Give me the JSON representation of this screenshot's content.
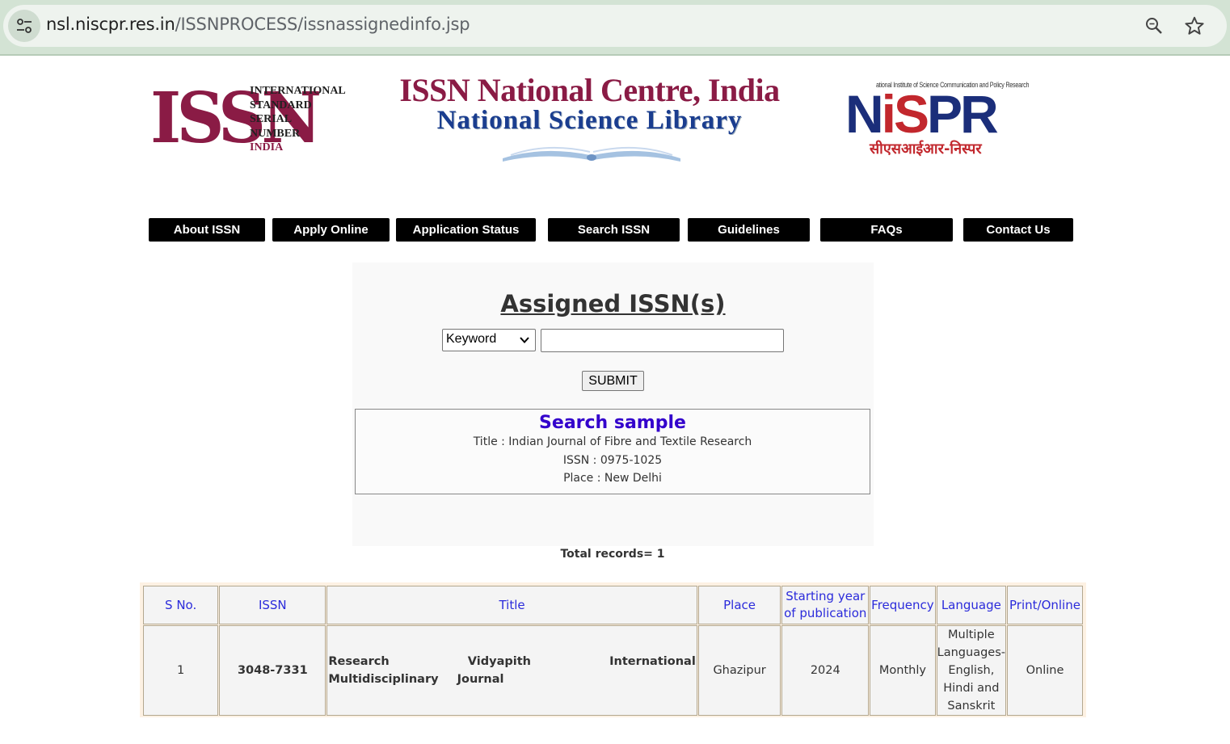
{
  "browser": {
    "url_domain": "nsl.niscpr.res.in",
    "url_path": "/ISSNPROCESS/issnassignedinfo.jsp"
  },
  "header": {
    "issn_logo": {
      "letters": "ISSN",
      "words": [
        "INTERNATIONAL",
        "STANDARD",
        "SERIAL",
        "NUMBER",
        "INDIA"
      ]
    },
    "title_main": "ISSN National Centre, India",
    "title_sub": "National Science Library",
    "niscpr_logo": {
      "small_text": "ational Institute of Science Communication and Policy Research",
      "main_left": "N",
      "main_mid": "iS",
      "main_right": "PR",
      "hindi": "सीएसआईआर-निस्पर"
    }
  },
  "nav": [
    {
      "label": "About ISSN"
    },
    {
      "label": "Apply Online"
    },
    {
      "label": "Application Status"
    },
    {
      "label": "Search ISSN"
    },
    {
      "label": "Guidelines"
    },
    {
      "label": "FAQs"
    },
    {
      "label": "Contact Us"
    }
  ],
  "search": {
    "heading": "Assigned ISSN(s)",
    "select_value": "Keyword",
    "input_value": "",
    "submit_label": "SUBMIT"
  },
  "sample": {
    "title": "Search sample",
    "lines": [
      "Title : Indian Journal of Fibre and Textile Research",
      "ISSN : 0975-1025",
      "Place : New Delhi"
    ]
  },
  "total_records": "Total records= 1",
  "table": {
    "headers": [
      "S No.",
      "ISSN",
      "Title",
      "Place",
      "Starting year of publication",
      "Frequency",
      "Language",
      "Print/Online"
    ],
    "rows": [
      {
        "sno": "1",
        "issn": "3048-7331",
        "title": "Research Vidyapith International Multidisciplinary Journal",
        "place": "Ghazipur",
        "year": "2024",
        "frequency": "Monthly",
        "language": "Multiple Languages- English, Hindi and Sanskrit",
        "print_online": "Online"
      }
    ]
  },
  "colors": {
    "brand_maroon": "#8a1b45",
    "brand_blue": "#1a3d8f",
    "link_blue": "#2b2bdb",
    "sample_title": "#3300cc"
  }
}
